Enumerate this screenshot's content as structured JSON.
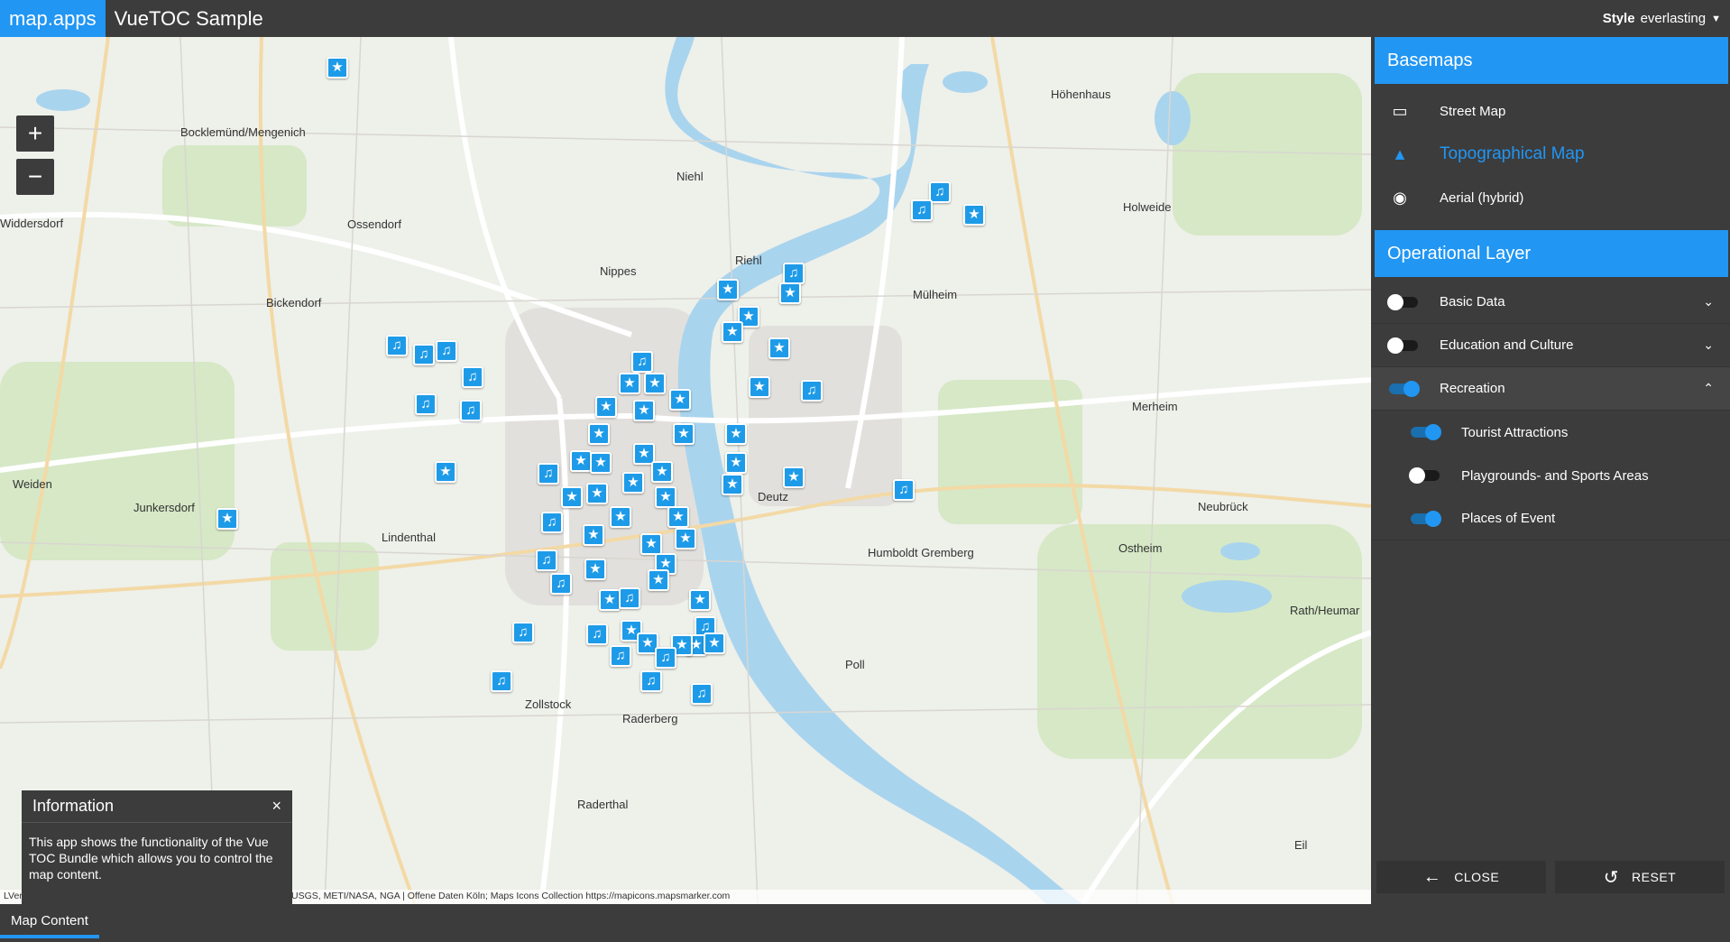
{
  "header": {
    "logo": "map.apps",
    "title": "VueTOC Sample",
    "style_label": "Style",
    "style_value": "everlasting"
  },
  "map": {
    "zoom_in": "+",
    "zoom_out": "−",
    "attribution": "LVermGeo RP, IGN, Kadaster, Esri, HERE, Garmin, INCREMENT P, USGS, METI/NASA, NGA | Offene Daten Köln; Maps Icons Collection https://mapicons.mapsmarker.com",
    "place_labels": [
      "Bocklemünd/Mengenich",
      "Ossendorf",
      "Niehl",
      "Riehl",
      "Nippes",
      "Bickendorf",
      "Widdersdorf",
      "Weiden",
      "Junkersdorf",
      "Lindenthal",
      "Deutz",
      "Mülheim",
      "Höhenhaus",
      "Holweide",
      "Merheim",
      "Neubrück",
      "Ostheim",
      "Humboldt Gremberg",
      "Poll",
      "Zollstock",
      "Raderberg",
      "Raderthal",
      "Rath/Heumar",
      "Eil"
    ]
  },
  "info": {
    "title": "Information",
    "close": "×",
    "text": "This app shows the functionality of the Vue TOC Bundle which allows you to control the map content."
  },
  "panel": {
    "basemaps_title": "Basemaps",
    "basemaps": [
      {
        "label": "Street Map",
        "icon": "monitor-icon"
      },
      {
        "label": "Topographical Map",
        "icon": "mountain-icon"
      },
      {
        "label": "Aerial (hybrid)",
        "icon": "camera-icon"
      }
    ],
    "operational_title": "Operational Layer",
    "layers": [
      {
        "label": "Basic Data",
        "on": false
      },
      {
        "label": "Education and Culture",
        "on": false
      },
      {
        "label": "Recreation",
        "on": true
      }
    ],
    "sublayers": [
      {
        "label": "Tourist Attractions",
        "on": true
      },
      {
        "label": "Playgrounds- and Sports Areas",
        "on": false
      },
      {
        "label": "Places of Event",
        "on": true
      }
    ],
    "close_label": "CLOSE",
    "reset_label": "RESET"
  },
  "footer": {
    "tab_label": "Map Content"
  },
  "colors": {
    "accent": "#2196f3",
    "dark": "#3c3c3c",
    "water": "#a9d4ee"
  }
}
